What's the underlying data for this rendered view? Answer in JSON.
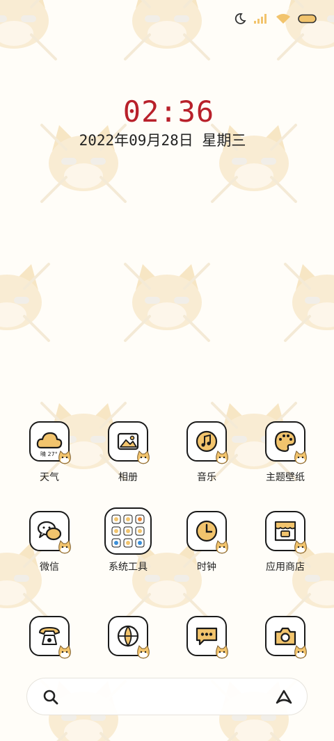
{
  "clock": {
    "time": "02:36",
    "date": "2022年09月28日 星期三"
  },
  "status_bar": {
    "icons": [
      "moon-icon",
      "signal-icon",
      "wifi-icon",
      "battery-icon"
    ]
  },
  "apps": [
    {
      "label": "天气",
      "icon": "weather-icon",
      "temp": "晴 27°"
    },
    {
      "label": "相册",
      "icon": "gallery-icon"
    },
    {
      "label": "音乐",
      "icon": "music-icon"
    },
    {
      "label": "主题壁纸",
      "icon": "theme-palette-icon"
    },
    {
      "label": "微信",
      "icon": "wechat-icon"
    },
    {
      "label": "系统工具",
      "icon": "tools-folder-icon"
    },
    {
      "label": "时钟",
      "icon": "clock-icon"
    },
    {
      "label": "应用商店",
      "icon": "app-store-icon"
    }
  ],
  "dock": [
    {
      "icon": "phone-icon"
    },
    {
      "icon": "browser-icon"
    },
    {
      "icon": "messages-icon"
    },
    {
      "icon": "camera-icon"
    }
  ],
  "search_bar": {
    "left_icon": "search-icon",
    "right_icon": "assistant-icon"
  },
  "colors": {
    "clock_time": "#b8202a",
    "accent": "#f2c46d",
    "outline": "#1a1a1a",
    "background": "#fffdf8"
  }
}
